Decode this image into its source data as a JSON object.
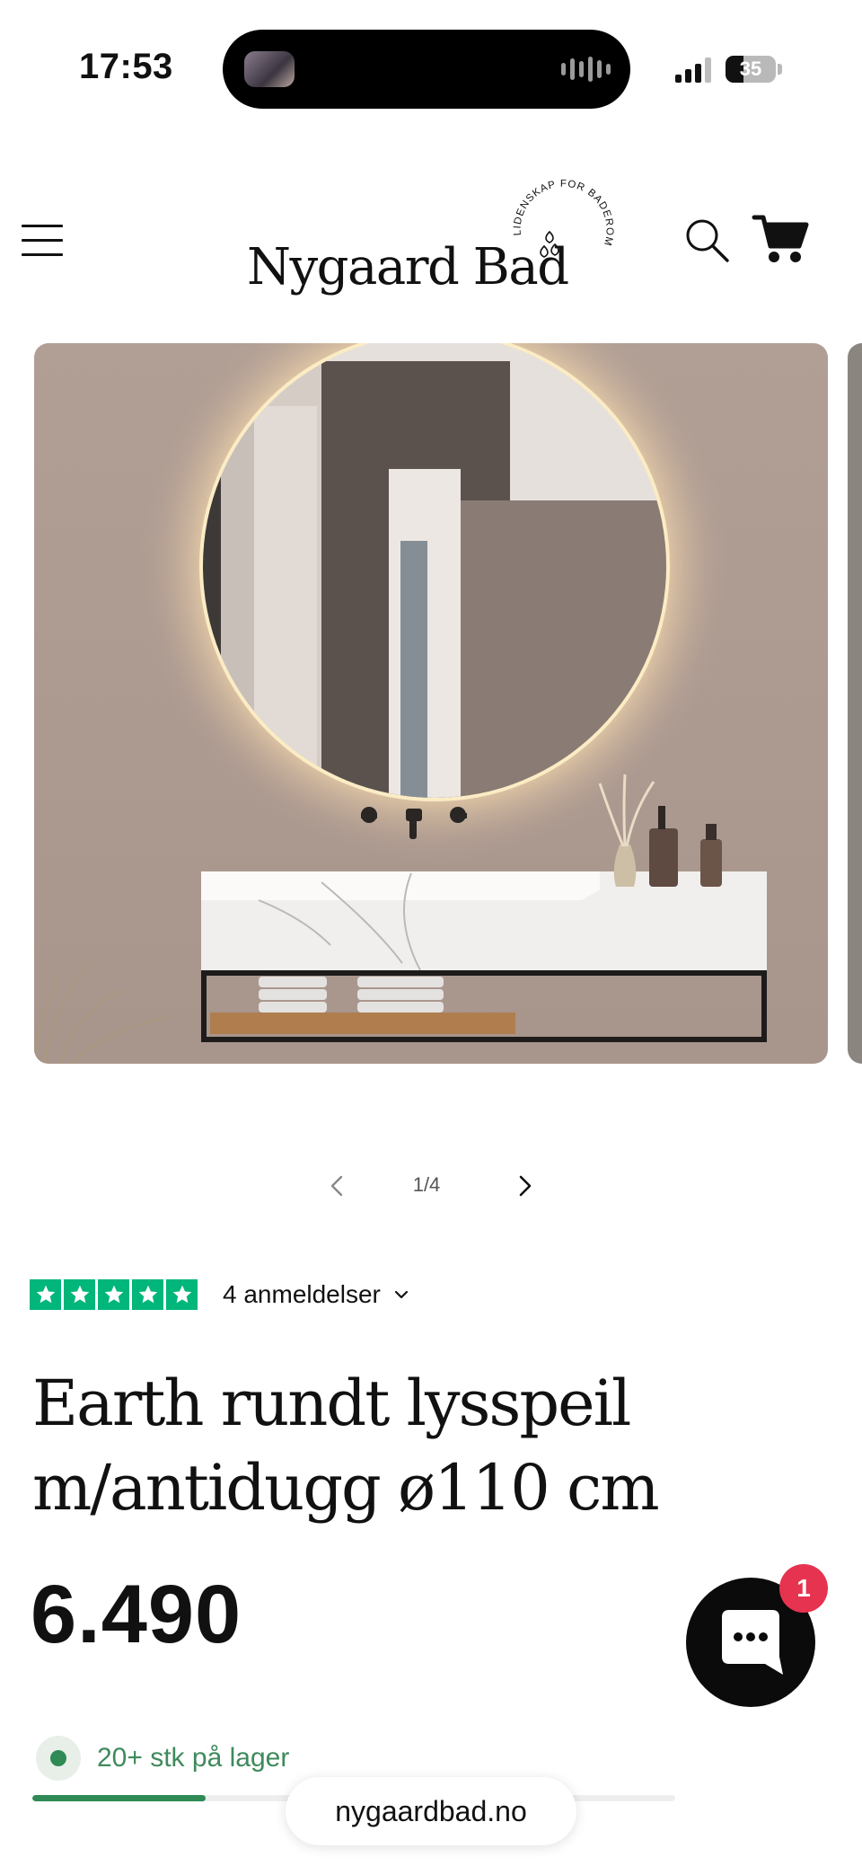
{
  "status_bar": {
    "time": "17:53",
    "battery": "35",
    "battery_level": 0.35
  },
  "header": {
    "brand": "Nygaard Bad",
    "badge_text": "LIDENSKAP FOR BADEROM",
    "icons": [
      "menu-icon",
      "search-icon",
      "cart-icon"
    ]
  },
  "gallery": {
    "counter": "1/4",
    "prev_icon": "chevron-left-icon",
    "next_icon": "chevron-right-icon"
  },
  "reviews": {
    "rating": 5,
    "label": "4 anmeldelser",
    "star_color": "#00b67a"
  },
  "product": {
    "title_line1": "Earth rundt lysspeil",
    "title_line2": "m/antidugg ø110 cm",
    "price": "6.490"
  },
  "stock": {
    "label": "20+ stk på lager",
    "level": 0.27,
    "color": "#2f8a55"
  },
  "chat": {
    "badge": "1",
    "icon": "chat-bubble-icon",
    "badge_color": "#e6334f"
  },
  "browser": {
    "url": "nygaardbad.no"
  }
}
